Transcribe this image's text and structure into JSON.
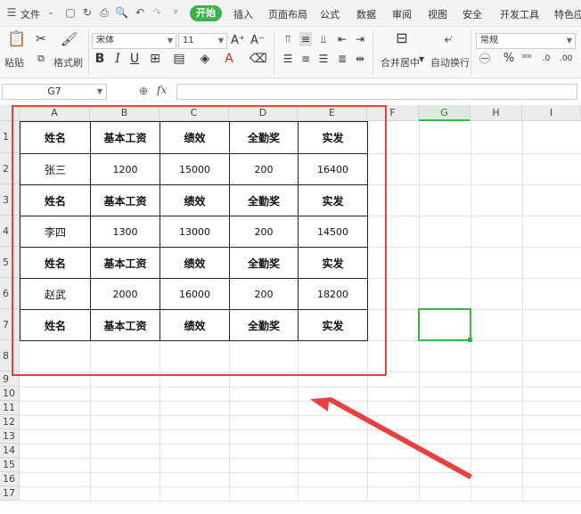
{
  "menu": {
    "file": "文件",
    "tabs": [
      "开始",
      "插入",
      "页面布局",
      "公式",
      "数据",
      "审阅",
      "视图",
      "安全",
      "开发工具",
      "特色应"
    ]
  },
  "ribbon": {
    "paste": "粘贴",
    "format_painter": "格式刷",
    "font_name": "宋体",
    "font_size": "11",
    "merge_center": "合并居中",
    "wrap_text": "自动换行",
    "number_format": "常规",
    "bold": "B",
    "italic": "I",
    "underline": "U",
    "font_color_glyph": "A",
    "percent": "%"
  },
  "formula_bar": {
    "name_box": "G7",
    "fx": "fx"
  },
  "sheet": {
    "columns": [
      "A",
      "B",
      "C",
      "D",
      "E",
      "F",
      "G",
      "H",
      "I"
    ],
    "active_column": "G",
    "rows": [
      "1",
      "2",
      "3",
      "4",
      "5",
      "6",
      "7",
      "8",
      "9",
      "10",
      "11",
      "12",
      "13",
      "14",
      "15",
      "16",
      "17"
    ],
    "table": [
      [
        "姓名",
        "基本工资",
        "绩效",
        "全勤奖",
        "实发"
      ],
      [
        "张三",
        "1200",
        "15000",
        "200",
        "16400"
      ],
      [
        "姓名",
        "基本工资",
        "绩效",
        "全勤奖",
        "实发"
      ],
      [
        "李四",
        "1300",
        "13000",
        "200",
        "14500"
      ],
      [
        "姓名",
        "基本工资",
        "绩效",
        "全勤奖",
        "实发"
      ],
      [
        "赵武",
        "2000",
        "16000",
        "200",
        "18200"
      ],
      [
        "姓名",
        "基本工资",
        "绩效",
        "全勤奖",
        "实发"
      ]
    ],
    "selected_cell": "G7"
  },
  "colors": {
    "accent": "#3bb34a",
    "annotation": "#e84040"
  }
}
